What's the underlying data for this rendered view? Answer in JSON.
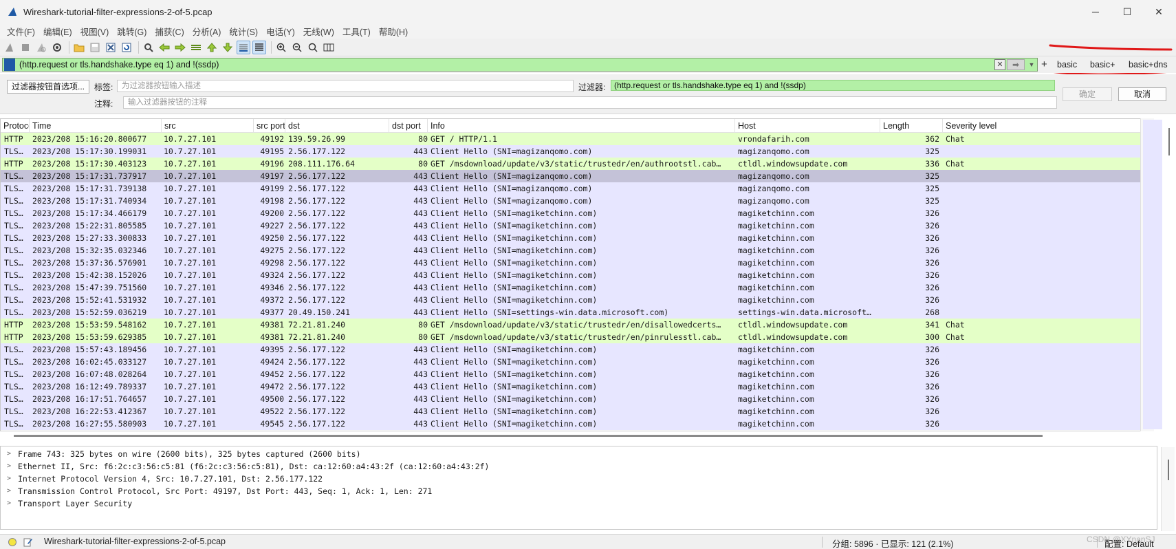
{
  "window": {
    "title": "Wireshark-tutorial-filter-expressions-2-of-5.pcap",
    "minimize_glyph": "─",
    "maximize_glyph": "☐",
    "close_glyph": "✕"
  },
  "menu": [
    "文件(F)",
    "编辑(E)",
    "视图(V)",
    "跳转(G)",
    "捕获(C)",
    "分析(A)",
    "统计(S)",
    "电话(Y)",
    "无线(W)",
    "工具(T)",
    "帮助(H)"
  ],
  "toolbar": {
    "icons": [
      "shark-fin-start-icon",
      "stop-icon",
      "restart-icon",
      "capture-options-icon",
      "open-folder-icon",
      "save-icon",
      "close-file-icon",
      "reload-icon",
      "find-icon",
      "back-icon",
      "forward-icon",
      "go-to-packet-icon",
      "first-packet-icon",
      "last-packet-icon",
      "autoscroll-icon",
      "colorize-icon",
      "zoom-in-icon",
      "zoom-out-icon",
      "zoom-normal-icon",
      "resize-columns-icon"
    ]
  },
  "filter_bar": {
    "value": "(http.request or tls.handshake.type eq 1) and !(ssdp)",
    "clear_glyph": "✕",
    "apply_glyph": "➡",
    "history_glyph": "▼",
    "add_glyph": "+",
    "buttons": [
      "basic",
      "basic+",
      "basic+dns"
    ]
  },
  "filter_editor": {
    "prefs_button": "过滤器按钮首选项...",
    "label_label": "标签:",
    "label_placeholder": "为过滤器按钮输入描述",
    "filter_label": "过滤器:",
    "filter_value": "(http.request or tls.handshake.type eq 1) and !(ssdp)",
    "comment_label": "注释:",
    "comment_placeholder": "输入过滤器按钮的注释",
    "ok": "确定",
    "cancel": "取消"
  },
  "packet_list": {
    "columns": [
      "Protocol",
      "Time",
      "src",
      "src port",
      "dst",
      "dst port",
      "Info",
      "Host",
      "Length",
      "Severity level"
    ],
    "rows": [
      {
        "proto": "HTTP",
        "time": "2023/208 15:16:20.800677",
        "src": "10.7.27.101",
        "sport": "49192",
        "dst": "139.59.26.99",
        "dport": "80",
        "info": "GET / HTTP/1.1",
        "host": "vrondafarih.com",
        "len": "362",
        "sev": "Chat",
        "kind": "http"
      },
      {
        "proto": "TLS…",
        "time": "2023/208 15:17:30.199031",
        "src": "10.7.27.101",
        "sport": "49195",
        "dst": "2.56.177.122",
        "dport": "443",
        "info": "Client Hello (SNI=magizanqomo.com)",
        "host": "magizanqomo.com",
        "len": "325",
        "sev": "",
        "kind": "tls"
      },
      {
        "proto": "HTTP",
        "time": "2023/208 15:17:30.403123",
        "src": "10.7.27.101",
        "sport": "49196",
        "dst": "208.111.176.64",
        "dport": "80",
        "info": "GET /msdownload/update/v3/static/trustedr/en/authrootstl.cab…",
        "host": "ctldl.windowsupdate.com",
        "len": "336",
        "sev": "Chat",
        "kind": "http"
      },
      {
        "proto": "TLS…",
        "time": "2023/208 15:17:31.737917",
        "src": "10.7.27.101",
        "sport": "49197",
        "dst": "2.56.177.122",
        "dport": "443",
        "info": "Client Hello (SNI=magizanqomo.com)",
        "host": "magizanqomo.com",
        "len": "325",
        "sev": "",
        "kind": "selected"
      },
      {
        "proto": "TLS…",
        "time": "2023/208 15:17:31.739138",
        "src": "10.7.27.101",
        "sport": "49199",
        "dst": "2.56.177.122",
        "dport": "443",
        "info": "Client Hello (SNI=magizanqomo.com)",
        "host": "magizanqomo.com",
        "len": "325",
        "sev": "",
        "kind": "tls"
      },
      {
        "proto": "TLS…",
        "time": "2023/208 15:17:31.740934",
        "src": "10.7.27.101",
        "sport": "49198",
        "dst": "2.56.177.122",
        "dport": "443",
        "info": "Client Hello (SNI=magizanqomo.com)",
        "host": "magizanqomo.com",
        "len": "325",
        "sev": "",
        "kind": "tls"
      },
      {
        "proto": "TLS…",
        "time": "2023/208 15:17:34.466179",
        "src": "10.7.27.101",
        "sport": "49200",
        "dst": "2.56.177.122",
        "dport": "443",
        "info": "Client Hello (SNI=magiketchinn.com)",
        "host": "magiketchinn.com",
        "len": "326",
        "sev": "",
        "kind": "tls"
      },
      {
        "proto": "TLS…",
        "time": "2023/208 15:22:31.805585",
        "src": "10.7.27.101",
        "sport": "49227",
        "dst": "2.56.177.122",
        "dport": "443",
        "info": "Client Hello (SNI=magiketchinn.com)",
        "host": "magiketchinn.com",
        "len": "326",
        "sev": "",
        "kind": "tls"
      },
      {
        "proto": "TLS…",
        "time": "2023/208 15:27:33.300833",
        "src": "10.7.27.101",
        "sport": "49250",
        "dst": "2.56.177.122",
        "dport": "443",
        "info": "Client Hello (SNI=magiketchinn.com)",
        "host": "magiketchinn.com",
        "len": "326",
        "sev": "",
        "kind": "tls"
      },
      {
        "proto": "TLS…",
        "time": "2023/208 15:32:35.032346",
        "src": "10.7.27.101",
        "sport": "49275",
        "dst": "2.56.177.122",
        "dport": "443",
        "info": "Client Hello (SNI=magiketchinn.com)",
        "host": "magiketchinn.com",
        "len": "326",
        "sev": "",
        "kind": "tls"
      },
      {
        "proto": "TLS…",
        "time": "2023/208 15:37:36.576901",
        "src": "10.7.27.101",
        "sport": "49298",
        "dst": "2.56.177.122",
        "dport": "443",
        "info": "Client Hello (SNI=magiketchinn.com)",
        "host": "magiketchinn.com",
        "len": "326",
        "sev": "",
        "kind": "tls"
      },
      {
        "proto": "TLS…",
        "time": "2023/208 15:42:38.152026",
        "src": "10.7.27.101",
        "sport": "49324",
        "dst": "2.56.177.122",
        "dport": "443",
        "info": "Client Hello (SNI=magiketchinn.com)",
        "host": "magiketchinn.com",
        "len": "326",
        "sev": "",
        "kind": "tls"
      },
      {
        "proto": "TLS…",
        "time": "2023/208 15:47:39.751560",
        "src": "10.7.27.101",
        "sport": "49346",
        "dst": "2.56.177.122",
        "dport": "443",
        "info": "Client Hello (SNI=magiketchinn.com)",
        "host": "magiketchinn.com",
        "len": "326",
        "sev": "",
        "kind": "tls"
      },
      {
        "proto": "TLS…",
        "time": "2023/208 15:52:41.531932",
        "src": "10.7.27.101",
        "sport": "49372",
        "dst": "2.56.177.122",
        "dport": "443",
        "info": "Client Hello (SNI=magiketchinn.com)",
        "host": "magiketchinn.com",
        "len": "326",
        "sev": "",
        "kind": "tls"
      },
      {
        "proto": "TLS…",
        "time": "2023/208 15:52:59.036219",
        "src": "10.7.27.101",
        "sport": "49377",
        "dst": "20.49.150.241",
        "dport": "443",
        "info": "Client Hello (SNI=settings-win.data.microsoft.com)",
        "host": "settings-win.data.microsoft…",
        "len": "268",
        "sev": "",
        "kind": "tls"
      },
      {
        "proto": "HTTP",
        "time": "2023/208 15:53:59.548162",
        "src": "10.7.27.101",
        "sport": "49381",
        "dst": "72.21.81.240",
        "dport": "80",
        "info": "GET /msdownload/update/v3/static/trustedr/en/disallowedcerts…",
        "host": "ctldl.windowsupdate.com",
        "len": "341",
        "sev": "Chat",
        "kind": "http"
      },
      {
        "proto": "HTTP",
        "time": "2023/208 15:53:59.629385",
        "src": "10.7.27.101",
        "sport": "49381",
        "dst": "72.21.81.240",
        "dport": "80",
        "info": "GET /msdownload/update/v3/static/trustedr/en/pinrulesstl.cab…",
        "host": "ctldl.windowsupdate.com",
        "len": "300",
        "sev": "Chat",
        "kind": "http"
      },
      {
        "proto": "TLS…",
        "time": "2023/208 15:57:43.189456",
        "src": "10.7.27.101",
        "sport": "49395",
        "dst": "2.56.177.122",
        "dport": "443",
        "info": "Client Hello (SNI=magiketchinn.com)",
        "host": "magiketchinn.com",
        "len": "326",
        "sev": "",
        "kind": "tls"
      },
      {
        "proto": "TLS…",
        "time": "2023/208 16:02:45.033127",
        "src": "10.7.27.101",
        "sport": "49424",
        "dst": "2.56.177.122",
        "dport": "443",
        "info": "Client Hello (SNI=magiketchinn.com)",
        "host": "magiketchinn.com",
        "len": "326",
        "sev": "",
        "kind": "tls"
      },
      {
        "proto": "TLS…",
        "time": "2023/208 16:07:48.028264",
        "src": "10.7.27.101",
        "sport": "49452",
        "dst": "2.56.177.122",
        "dport": "443",
        "info": "Client Hello (SNI=magiketchinn.com)",
        "host": "magiketchinn.com",
        "len": "326",
        "sev": "",
        "kind": "tls"
      },
      {
        "proto": "TLS…",
        "time": "2023/208 16:12:49.789337",
        "src": "10.7.27.101",
        "sport": "49472",
        "dst": "2.56.177.122",
        "dport": "443",
        "info": "Client Hello (SNI=magiketchinn.com)",
        "host": "magiketchinn.com",
        "len": "326",
        "sev": "",
        "kind": "tls"
      },
      {
        "proto": "TLS…",
        "time": "2023/208 16:17:51.764657",
        "src": "10.7.27.101",
        "sport": "49500",
        "dst": "2.56.177.122",
        "dport": "443",
        "info": "Client Hello (SNI=magiketchinn.com)",
        "host": "magiketchinn.com",
        "len": "326",
        "sev": "",
        "kind": "tls"
      },
      {
        "proto": "TLS…",
        "time": "2023/208 16:22:53.412367",
        "src": "10.7.27.101",
        "sport": "49522",
        "dst": "2.56.177.122",
        "dport": "443",
        "info": "Client Hello (SNI=magiketchinn.com)",
        "host": "magiketchinn.com",
        "len": "326",
        "sev": "",
        "kind": "tls"
      },
      {
        "proto": "TLS…",
        "time": "2023/208 16:27:55.580903",
        "src": "10.7.27.101",
        "sport": "49545",
        "dst": "2.56.177.122",
        "dport": "443",
        "info": "Client Hello (SNI=magiketchinn.com)",
        "host": "magiketchinn.com",
        "len": "326",
        "sev": "",
        "kind": "tls"
      }
    ]
  },
  "details": {
    "expand_glyph": ">",
    "rows": [
      "Frame 743: 325 bytes on wire (2600 bits), 325 bytes captured (2600 bits)",
      "Ethernet II, Src: f6:2c:c3:56:c5:81 (f6:2c:c3:56:c5:81), Dst: ca:12:60:a4:43:2f (ca:12:60:a4:43:2f)",
      "Internet Protocol Version 4, Src: 10.7.27.101, Dst: 2.56.177.122",
      "Transmission Control Protocol, Src Port: 49197, Dst Port: 443, Seq: 1, Ack: 1, Len: 271",
      "Transport Layer Security"
    ]
  },
  "status": {
    "file": "Wireshark-tutorial-filter-expressions-2-of-5.pcap",
    "counts": "分组: 5896 · 已显示: 121 (2.1%)",
    "profile": "配置: Default",
    "watermark": "CSDN @XYnanSJ"
  },
  "colors": {
    "http_row": "#e4ffc7",
    "tls_row": "#e7e6ff",
    "selected_row": "#c4c2d8",
    "filter_valid": "#b3f0a6",
    "annotation_red": "#e01818"
  }
}
